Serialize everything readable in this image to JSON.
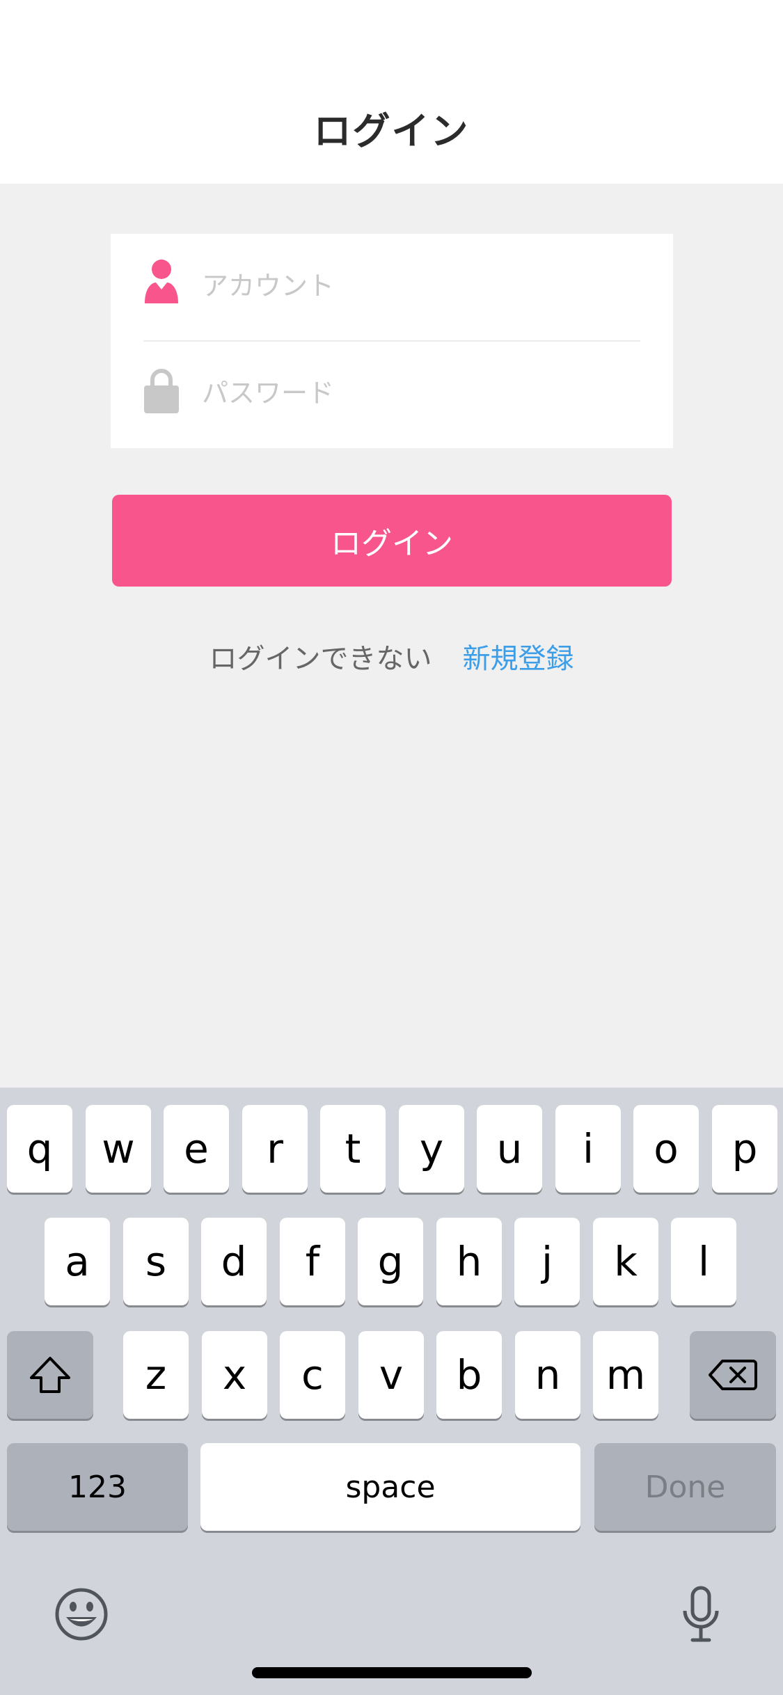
{
  "header": {
    "title": "ログイン"
  },
  "form": {
    "account_placeholder": "アカウント",
    "password_placeholder": "パスワード",
    "account_icon": "user-icon",
    "password_icon": "lock-icon"
  },
  "login_button_label": "ログイン",
  "links": {
    "cant_login": "ログインできない",
    "register": "新規登録"
  },
  "colors": {
    "accent": "#f8558d",
    "link": "#3c9ee8",
    "background": "#f0f0f0"
  },
  "keyboard": {
    "row1": [
      "q",
      "w",
      "e",
      "r",
      "t",
      "y",
      "u",
      "i",
      "o",
      "p"
    ],
    "row2": [
      "a",
      "s",
      "d",
      "f",
      "g",
      "h",
      "j",
      "k",
      "l"
    ],
    "row3": [
      "z",
      "x",
      "c",
      "v",
      "b",
      "n",
      "m"
    ],
    "numbers_label": "123",
    "space_label": "space",
    "done_label": "Done",
    "icons": [
      "shift-icon",
      "delete-icon",
      "emoji-icon",
      "microphone-icon"
    ]
  }
}
